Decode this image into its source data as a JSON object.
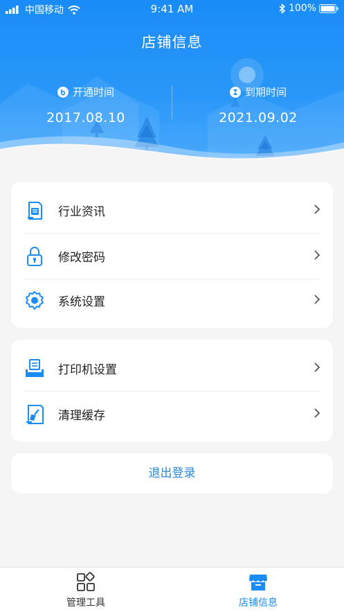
{
  "status_bar": {
    "carrier": "中国移动",
    "time": "9:41 AM",
    "battery": "100%"
  },
  "header": {
    "title": "店铺信息",
    "open_time_label": "开通时间",
    "open_time_value": "2017.08.10",
    "expire_time_label": "到期时间",
    "expire_time_value": "2021.09.02"
  },
  "menu_group_1": [
    {
      "label": "行业资讯",
      "icon": "news-icon"
    },
    {
      "label": "修改密码",
      "icon": "lock-icon"
    },
    {
      "label": "系统设置",
      "icon": "gear-icon"
    }
  ],
  "menu_group_2": [
    {
      "label": "打印机设置",
      "icon": "printer-icon"
    },
    {
      "label": "清理缓存",
      "icon": "broom-icon"
    }
  ],
  "logout": {
    "label": "退出登录"
  },
  "tabbar": {
    "tabs": [
      {
        "label": "管理工具",
        "icon": "apps-icon",
        "active": false
      },
      {
        "label": "店铺信息",
        "icon": "shop-icon",
        "active": true
      }
    ]
  },
  "colors": {
    "primary": "#1a8cf7",
    "text": "#222222",
    "link": "#2a8ae0"
  }
}
